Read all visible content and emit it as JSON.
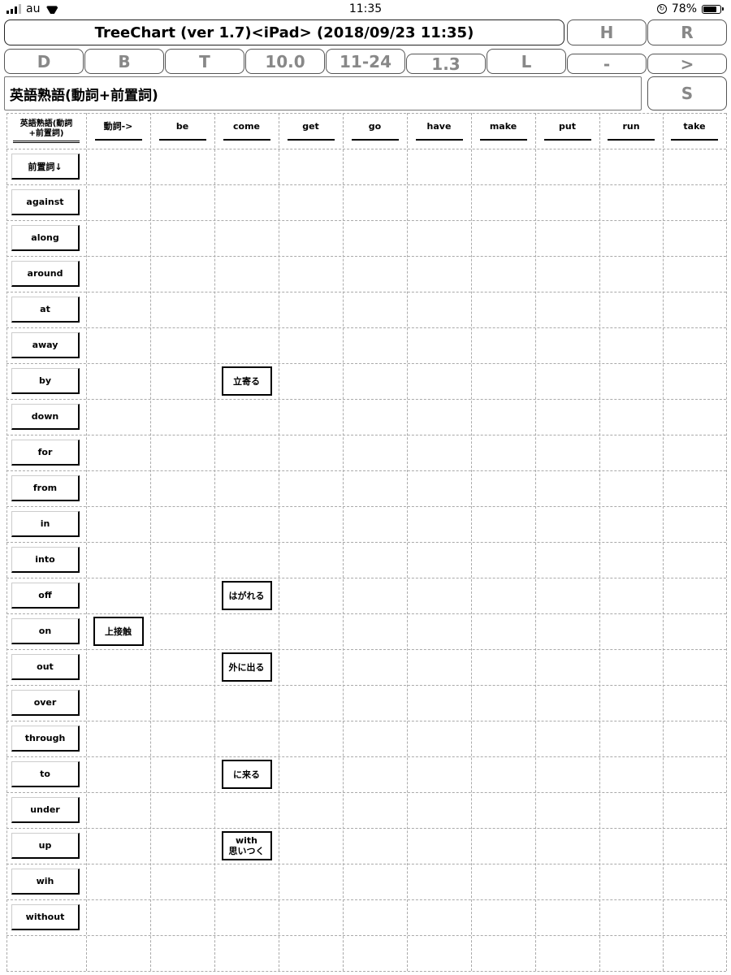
{
  "status_bar": {
    "carrier": "au",
    "time": "11:35",
    "battery": "78%",
    "battery_level": 0.78
  },
  "toolbar": {
    "title": "TreeChart (ver 1.7)<iPad> (2018/09/23 11:35)",
    "h_label": "H",
    "r_label": "R",
    "d_label": "D",
    "b_label": "B",
    "t_label": "T",
    "zoom_label": "10.0",
    "range_label": "11-24",
    "scale_label": "1.3",
    "l_label": "L",
    "minus_label": "-",
    "next_label": ">",
    "s_label": "S"
  },
  "heading": "英語熟語(動詞+前置詞)",
  "grid": {
    "corner_label_line1": "英語熟語(動詞",
    "corner_label_line2": "+前置詞)",
    "verb_header": "動詞->",
    "verbs": [
      "be",
      "come",
      "get",
      "go",
      "have",
      "make",
      "put",
      "run",
      "take"
    ],
    "prep_header": "前置詞↓",
    "prepositions": [
      "against",
      "along",
      "around",
      "at",
      "away",
      "by",
      "down",
      "for",
      "from",
      "in",
      "into",
      "off",
      "on",
      "out",
      "over",
      "through",
      "to",
      "under",
      "up",
      "wih",
      "without"
    ],
    "entries": [
      {
        "row": "by",
        "col": "come",
        "text": "立寄る"
      },
      {
        "row": "off",
        "col": "come",
        "text": "はがれる"
      },
      {
        "row": "on",
        "col": "verb_header",
        "text": "上接触"
      },
      {
        "row": "out",
        "col": "come",
        "text": "外に出る"
      },
      {
        "row": "to",
        "col": "come",
        "text": "に来る"
      },
      {
        "row": "up",
        "col": "come",
        "text_line1": "with",
        "text_line2": "思いつく"
      }
    ]
  }
}
